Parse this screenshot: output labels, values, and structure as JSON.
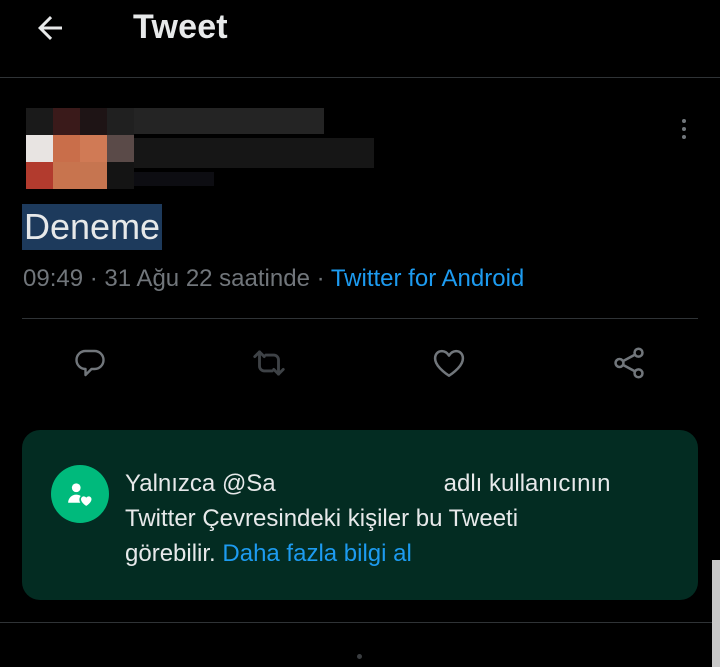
{
  "header": {
    "title": "Tweet",
    "back_icon": "arrow-left-icon"
  },
  "tweet": {
    "text": "Deneme",
    "time": "09:49",
    "date": "31 Ağu 22 saatinde",
    "separator": "·",
    "source": "Twitter for Android"
  },
  "actions": {
    "reply_icon": "reply-icon",
    "retweet_icon": "retweet-icon",
    "like_icon": "heart-icon",
    "share_icon": "share-icon"
  },
  "notice": {
    "line1_prefix": "Yalnızca @Sa",
    "line1_suffix": "adlı kullanıcının",
    "line2": "Twitter Çevresindeki kişiler bu Tweeti",
    "line3_prefix": "görebilir.",
    "link": "Daha fazla bilgi al",
    "icon": "circle-people-icon"
  },
  "colors": {
    "background": "#000000",
    "accent": "#1d9bf0",
    "notice_bg": "#032c22",
    "notice_icon": "#00ba7c",
    "muted": "#71767b"
  }
}
